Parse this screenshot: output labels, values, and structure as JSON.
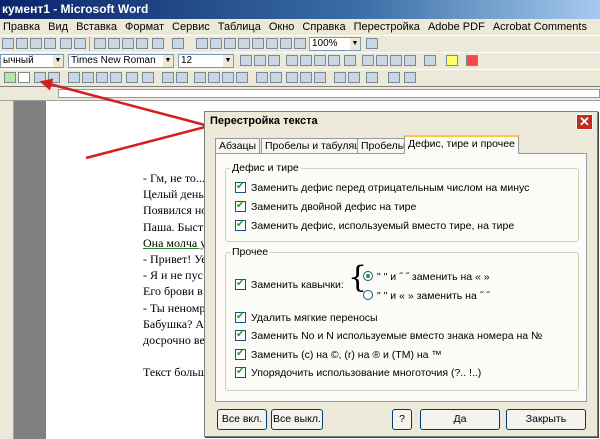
{
  "window": {
    "title": "кумент1 - Microsoft Word"
  },
  "menu": [
    "Правка",
    "Вид",
    "Вставка",
    "Формат",
    "Сервис",
    "Таблица",
    "Окно",
    "Справка",
    "Перестройка",
    "Adobe PDF",
    "Acrobat Comments"
  ],
  "toolbar": {
    "zoom": "100%",
    "style": "ычный",
    "font": "Times New Roman",
    "size": "12"
  },
  "document": {
    "lines": [
      "- Гм, не то...",
      "Целый день",
      "Появился но",
      "Паша. Быстр",
      "Она молча у",
      "- Привет! Уе",
      "- Я и не пус",
      "Его брови в",
      "- Ты неномр",
      "Бабушка? А",
      "досрочно ве",
      "",
      "Текст больш"
    ]
  },
  "dialog": {
    "title": "Перестройка текста",
    "close": "✕",
    "tabs": [
      "Абзацы",
      "Пробелы и табуляции",
      "Пробелы",
      "Дефис, тире и прочее"
    ],
    "group1": {
      "legend": "Дефис и тире",
      "items": [
        "Заменить дефис перед отрицательным числом на минус",
        "Заменить двойной дефис на тире",
        "Заменить дефис, используемый вместо тире, на тире"
      ]
    },
    "group2": {
      "legend": "Прочее",
      "quotes_label": "Заменить кавычки:",
      "radio1": "\" \" и ˝ ˝ заменить на « »",
      "radio2": "\" \" и « »  заменить на  ˝ ˝",
      "items": [
        "Удалить мягкие переносы",
        "Заменить No и N используемые вместо знака номера на №",
        "Заменить (c) на ©, (r) на ® и (TM) на ™",
        "Упорядочить использование многоточия (?.. !..)"
      ]
    },
    "buttons": {
      "all_on": "Все вкл.",
      "all_off": "Все выкл.",
      "help": "?",
      "ok": "Да",
      "close": "Закрыть"
    }
  },
  "colors": {
    "arrow": "#d42020",
    "check": "#21a121",
    "title_bar": "#0a246a"
  }
}
